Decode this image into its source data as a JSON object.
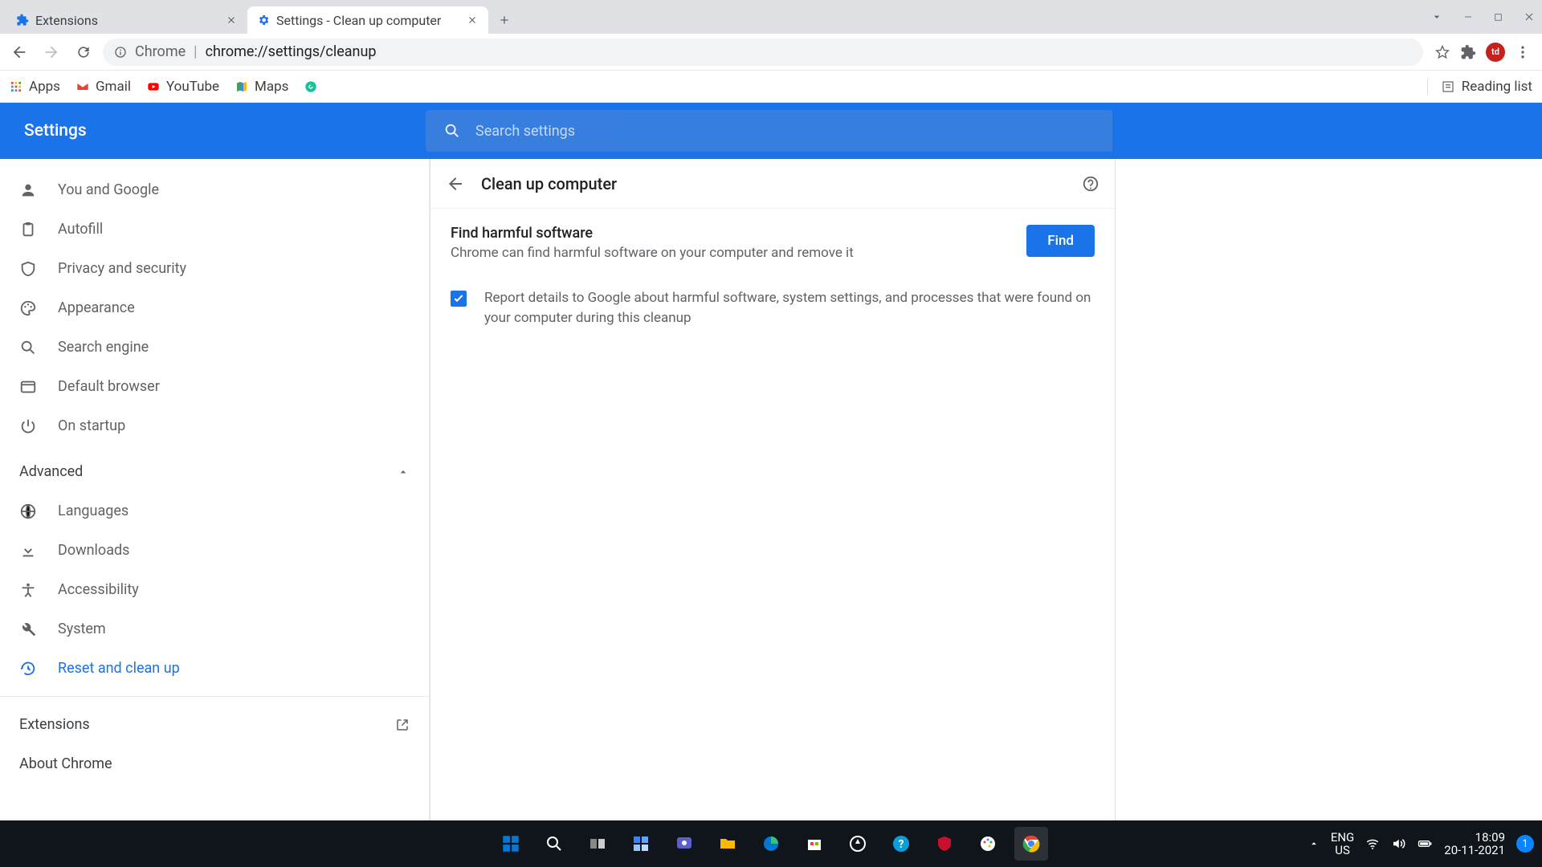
{
  "tabs": [
    {
      "title": "Extensions",
      "active": false
    },
    {
      "title": "Settings - Clean up computer",
      "active": true
    }
  ],
  "omnibox": {
    "prefix": "Chrome",
    "url": "chrome://settings/cleanup"
  },
  "bookmarks": {
    "items": [
      "Apps",
      "Gmail",
      "YouTube",
      "Maps"
    ],
    "reading_list": "Reading list"
  },
  "settings_header": {
    "title": "Settings",
    "search_placeholder": "Search settings"
  },
  "sidebar": {
    "items": [
      {
        "label": "You and Google"
      },
      {
        "label": "Autofill"
      },
      {
        "label": "Privacy and security"
      },
      {
        "label": "Appearance"
      },
      {
        "label": "Search engine"
      },
      {
        "label": "Default browser"
      },
      {
        "label": "On startup"
      }
    ],
    "advanced_label": "Advanced",
    "advanced_items": [
      {
        "label": "Languages"
      },
      {
        "label": "Downloads"
      },
      {
        "label": "Accessibility"
      },
      {
        "label": "System"
      },
      {
        "label": "Reset and clean up",
        "active": true
      }
    ],
    "extensions_label": "Extensions",
    "about_label": "About Chrome"
  },
  "page": {
    "title": "Clean up computer",
    "find_title": "Find harmful software",
    "find_desc": "Chrome can find harmful software on your computer and remove it",
    "find_button": "Find",
    "report_label": "Report details to Google about harmful software, system settings, and processes that were found on your computer during this cleanup",
    "report_checked": true
  },
  "taskbar": {
    "lang_top": "ENG",
    "lang_bottom": "US",
    "time": "18:09",
    "date": "20-11-2021",
    "notif_count": "1"
  }
}
